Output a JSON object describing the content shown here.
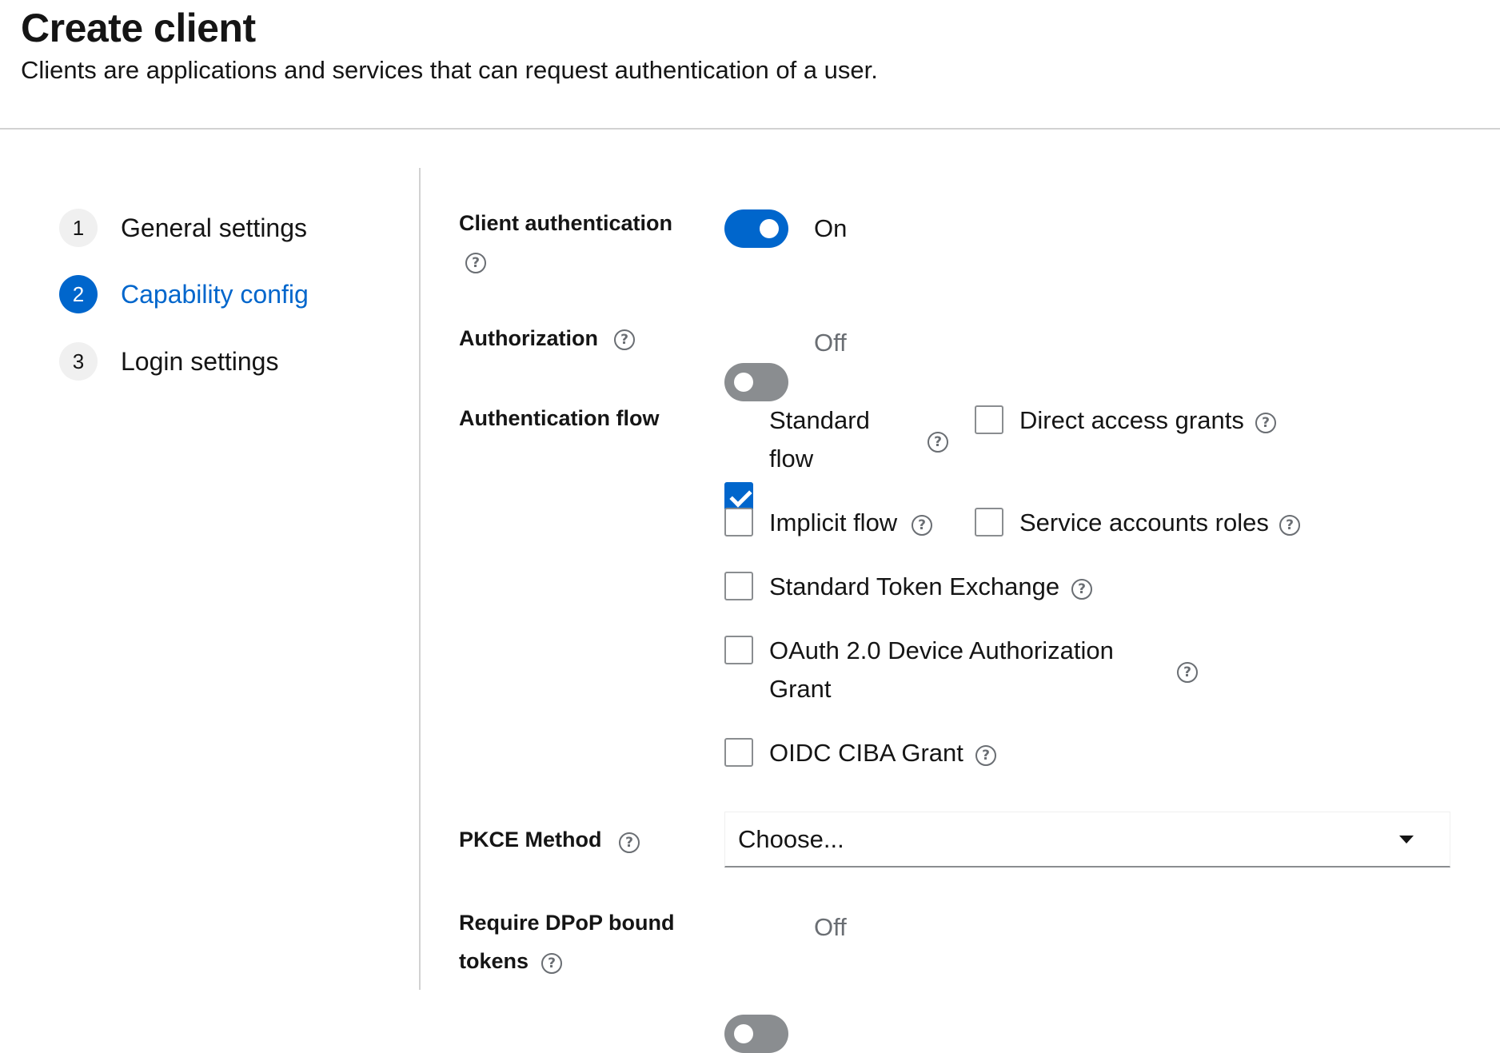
{
  "header": {
    "title": "Create client",
    "description": "Clients are applications and services that can request authentication of a user."
  },
  "wizard": {
    "steps": [
      {
        "number": "1",
        "label": "General settings",
        "active": false
      },
      {
        "number": "2",
        "label": "Capability config",
        "active": true
      },
      {
        "number": "3",
        "label": "Login settings",
        "active": false
      }
    ]
  },
  "form": {
    "client_auth": {
      "label": "Client authentication",
      "state": "On",
      "enabled": true
    },
    "authorization": {
      "label": "Authorization",
      "state": "Off",
      "enabled": false
    },
    "auth_flow": {
      "label": "Authentication flow",
      "options": [
        {
          "label_line1": "Standard",
          "label_line2": "flow",
          "checked": true
        },
        {
          "label": "Direct access grants",
          "checked": false
        },
        {
          "label": "Implicit flow",
          "checked": false
        },
        {
          "label": "Service accounts roles",
          "checked": false
        },
        {
          "label": "Standard Token Exchange",
          "checked": false
        },
        {
          "label_line1": "OAuth 2.0 Device Authorization",
          "label_line2": "Grant",
          "checked": false
        },
        {
          "label": "OIDC CIBA Grant",
          "checked": false
        }
      ]
    },
    "pkce": {
      "label": "PKCE Method",
      "selected": "Choose..."
    },
    "dpop": {
      "label_line1": "Require DPoP bound",
      "label_line2": "tokens",
      "state": "Off",
      "enabled": false
    }
  },
  "icons": {
    "help": "help-circle-icon",
    "dropdown": "caret-down-icon",
    "check": "check-icon"
  },
  "colors": {
    "accent": "#0066cc",
    "switch_off": "#8a8d90",
    "text": "#151515",
    "muted": "#6a6e73",
    "divider": "#d2d2d2"
  }
}
